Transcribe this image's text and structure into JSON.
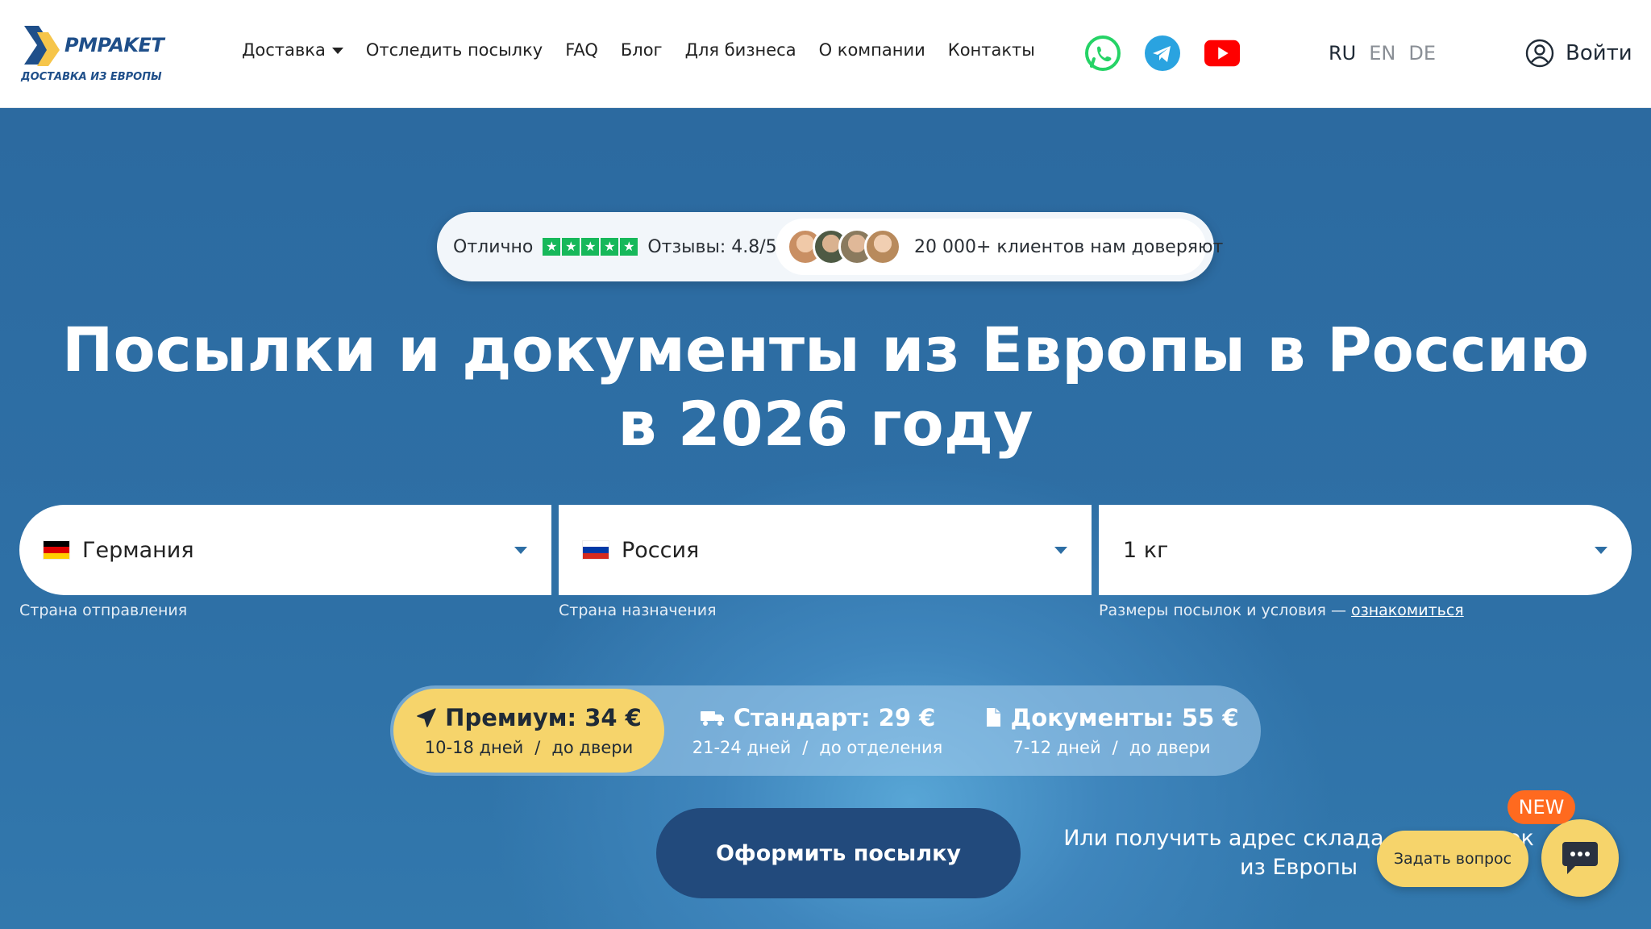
{
  "brand": {
    "name": "PMPAKET",
    "tagline": "ДОСТАВКА ИЗ ЕВРОПЫ"
  },
  "nav": {
    "items": [
      {
        "label": "Доставка",
        "has_dropdown": true
      },
      {
        "label": "Отследить посылку"
      },
      {
        "label": "FAQ"
      },
      {
        "label": "Блог"
      },
      {
        "label": "Для бизнеса"
      },
      {
        "label": "О компании"
      },
      {
        "label": "Контакты"
      }
    ]
  },
  "socials": [
    {
      "icon": "whatsapp-icon",
      "color": "#25D366"
    },
    {
      "icon": "telegram-icon",
      "color": "#2AA3E0"
    },
    {
      "icon": "youtube-icon",
      "color": "#FF0000"
    }
  ],
  "languages": [
    {
      "code": "RU",
      "active": true
    },
    {
      "code": "EN",
      "active": false
    },
    {
      "code": "DE",
      "active": false
    }
  ],
  "login": {
    "label": "Войти"
  },
  "rating": {
    "label": "Отлично",
    "reviews": "Отзывы: 4.8/5",
    "trust": "20 000+ клиентов нам доверяют",
    "stars_color": "#17B85A"
  },
  "hero": {
    "title": "Посылки и документы из Европы в Россию в 2026 году"
  },
  "calculator": {
    "origin": {
      "value": "Германия",
      "hint": "Страна отправления"
    },
    "destination": {
      "value": "Россия",
      "hint": "Страна назначения"
    },
    "weight": {
      "value": "1 кг",
      "hint": "Размеры посылок и условия —",
      "hint_link": "ознакомиться"
    }
  },
  "tariffs": [
    {
      "name": "Премиум: 34 €",
      "days": "10-18 дней",
      "delivery": "до двери",
      "selected": true,
      "icon": "plane-icon"
    },
    {
      "name": "Стандарт: 29 €",
      "days": "21-24 дней",
      "delivery": "до отделения",
      "selected": false,
      "icon": "truck-icon"
    },
    {
      "name": "Документы: 55 €",
      "days": "7-12 дней",
      "delivery": "до двери",
      "selected": false,
      "icon": "document-icon"
    }
  ],
  "order_button": {
    "label": "Оформить посылку"
  },
  "warehouse_text": "Или получить адрес склада для покупок из Европы",
  "chat": {
    "ask_label": "Задать вопрос",
    "badge": "NEW"
  },
  "colors": {
    "accent_yellow": "#F6D46B",
    "hero_blue": "#2D6EA4",
    "button_navy": "#224A7C",
    "badge_orange": "#FF6A1F"
  }
}
